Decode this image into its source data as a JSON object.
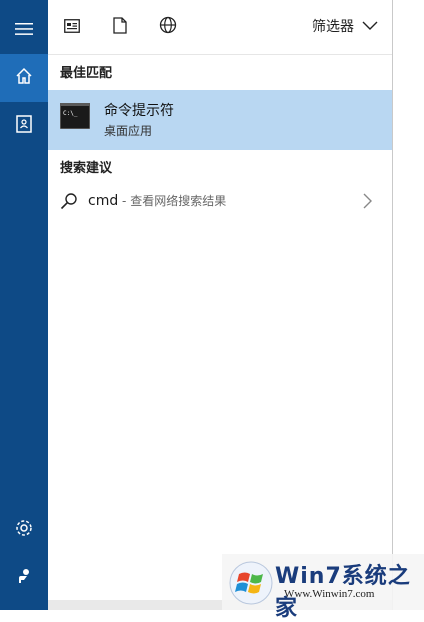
{
  "nav": {
    "items": [
      {
        "name": "menu-icon"
      },
      {
        "name": "home-icon"
      },
      {
        "name": "notebook-icon"
      },
      {
        "name": "settings-icon"
      },
      {
        "name": "feedback-icon"
      }
    ],
    "bg_color": "#0e4a86",
    "active_color": "#1f6db8"
  },
  "toolbar": {
    "icons": [
      "apps-icon",
      "document-icon",
      "web-icon"
    ],
    "filter_label": "筛选器"
  },
  "best_match": {
    "section_title": "最佳匹配",
    "app_name": "命令提示符",
    "app_type": "桌面应用",
    "highlight_color": "#b9d7f2"
  },
  "suggestions": {
    "section_title": "搜索建议",
    "items": [
      {
        "query": "cmd",
        "desc": " - 查看网络搜索结果"
      }
    ]
  },
  "watermark": {
    "brand": "Win7系统之家",
    "url": "Www.Winwin7.com"
  }
}
